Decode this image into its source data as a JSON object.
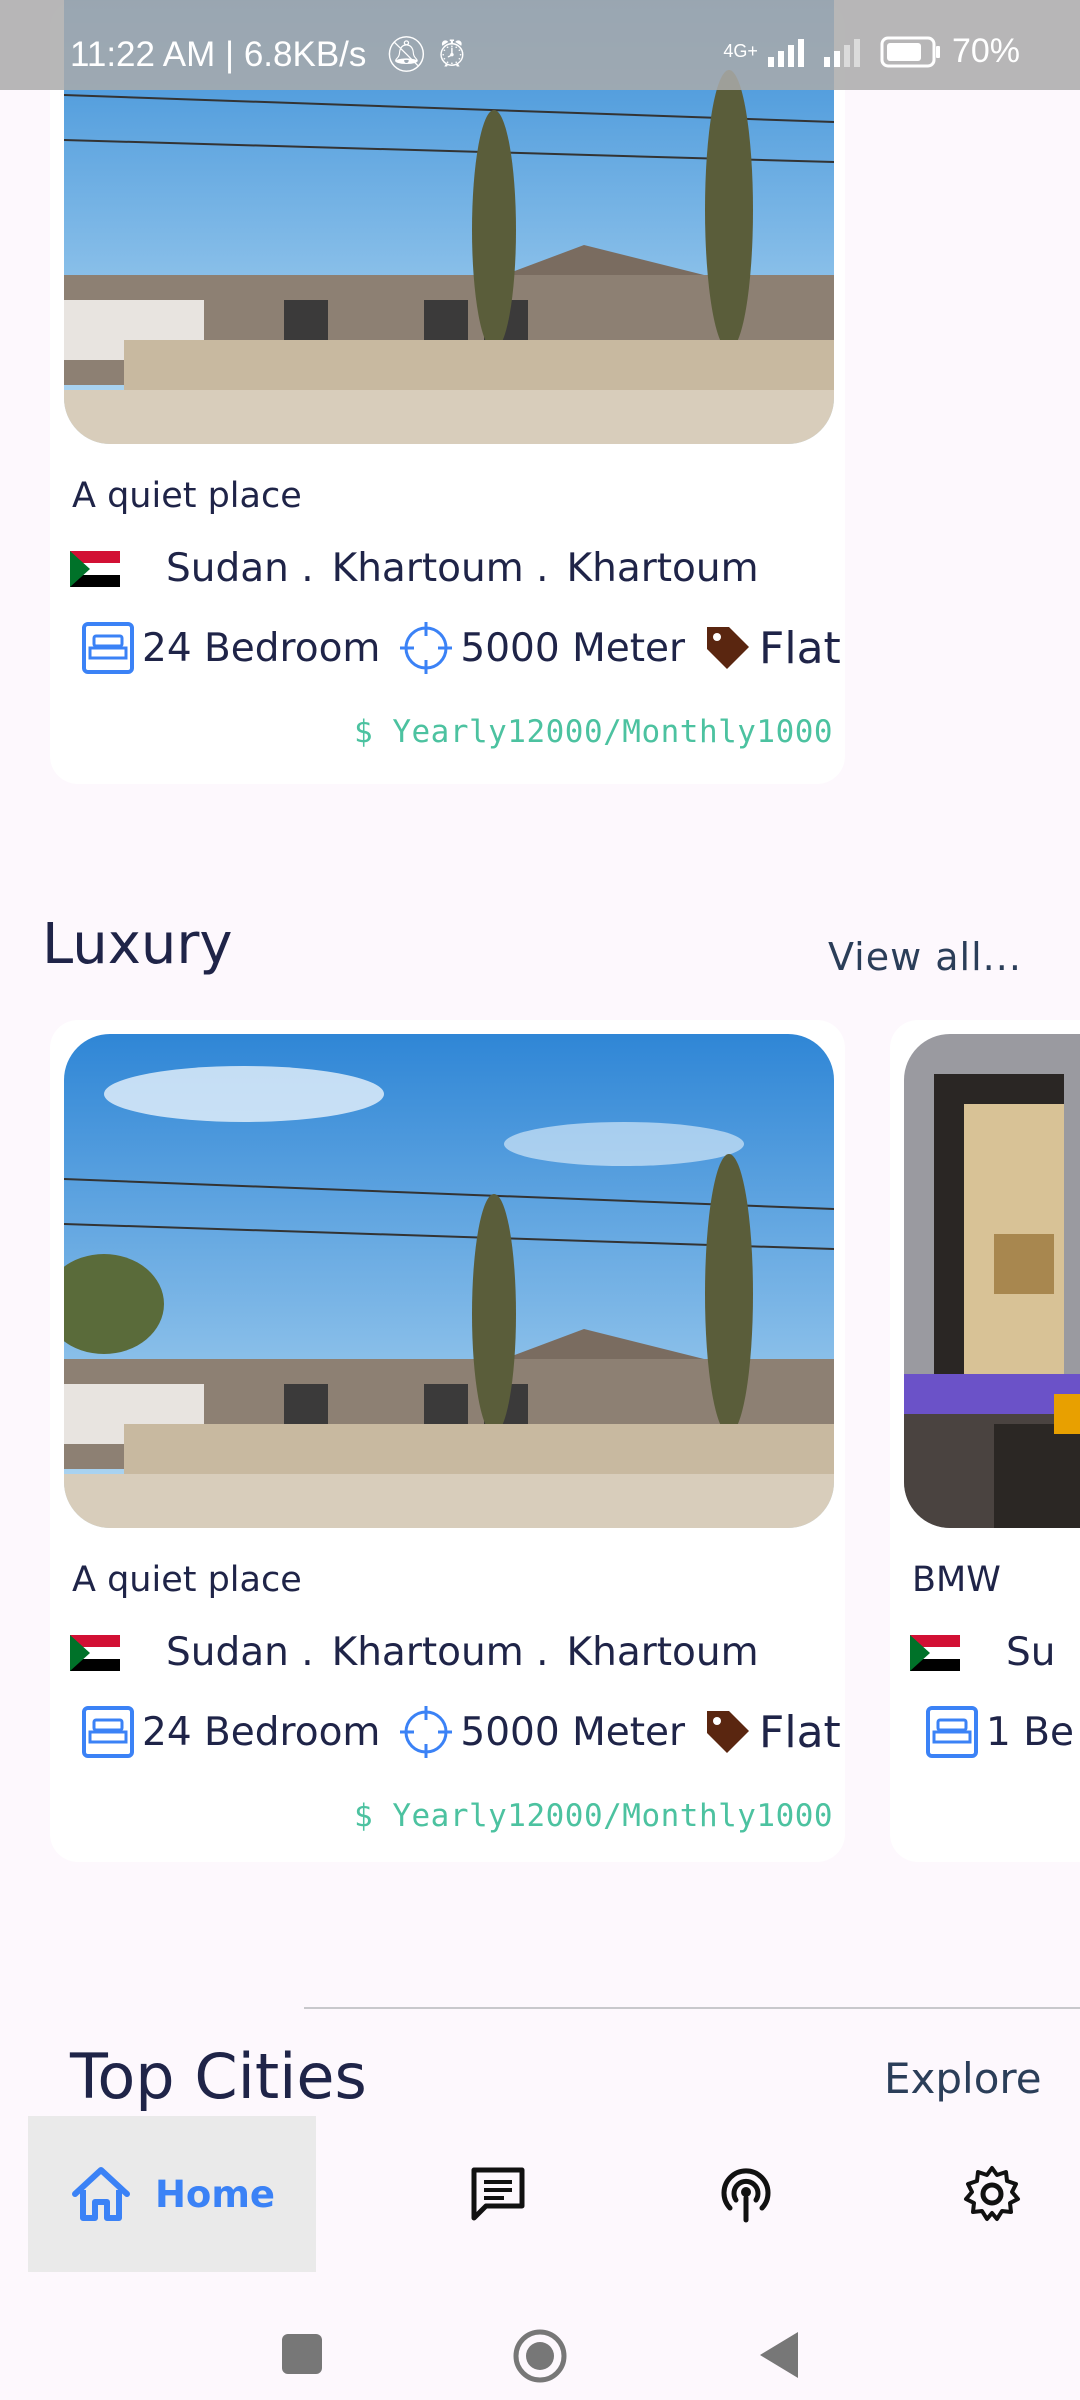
{
  "status_bar": {
    "time_info": "11:22 AM | 6.8KB/s",
    "network": "4G+",
    "battery": "70%"
  },
  "top_card": {
    "title": "A quiet place",
    "country": "Sudan .",
    "state": "Khartoum .",
    "city": "Khartoum",
    "bedrooms": "24 Bedroom",
    "area": "5000 Meter",
    "type": "Flat",
    "price": "$ Yearly12000/Monthly1000"
  },
  "luxury_section": {
    "title": "Luxury",
    "view_all": "View all...",
    "cards": [
      {
        "title": "A quiet place",
        "country": "Sudan .",
        "state": "Khartoum .",
        "city": "Khartoum",
        "bedrooms": "24 Bedroom",
        "area": "5000 Meter",
        "type": "Flat",
        "price": "$ Yearly12000/Monthly1000"
      },
      {
        "title": "BMW",
        "country": "Su",
        "bedrooms": "1 Be"
      }
    ]
  },
  "top_cities": {
    "title": "Top Cities",
    "explore": "Explore"
  },
  "bottom_nav": {
    "home_label": "Home",
    "accent": "#3b82f6"
  }
}
